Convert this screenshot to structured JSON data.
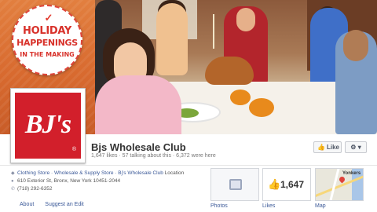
{
  "cover": {
    "badge": {
      "line1": "HOLIDAY",
      "line2": "HAPPENINGS",
      "line3": "IN THE MAKING"
    }
  },
  "profile": {
    "logo_text": "BJ's"
  },
  "page": {
    "name": "Bjs Wholesale Club",
    "stats": "1,647 likes · 57 talking about this · 6,372 were here"
  },
  "actions": {
    "like_label": "Like",
    "gear_caret": "▾"
  },
  "info": {
    "categories": "Clothing Store · Wholesale & Supply Store · Bj's Wholesale Club",
    "categories_suffix": " Location",
    "address": "610 Exterior St, Bronx, New York 10451-2044",
    "phone": "(718) 292-6352"
  },
  "bottom_links": {
    "about": "About",
    "suggest": "Suggest an Edit"
  },
  "tiles": {
    "photos_label": "Photos",
    "likes_label": "Likes",
    "likes_count": "1,647",
    "map_label": "Map",
    "map_city": "Yonkers"
  },
  "colors": {
    "brand_red": "#d21f2b",
    "link_blue": "#3b5998"
  }
}
